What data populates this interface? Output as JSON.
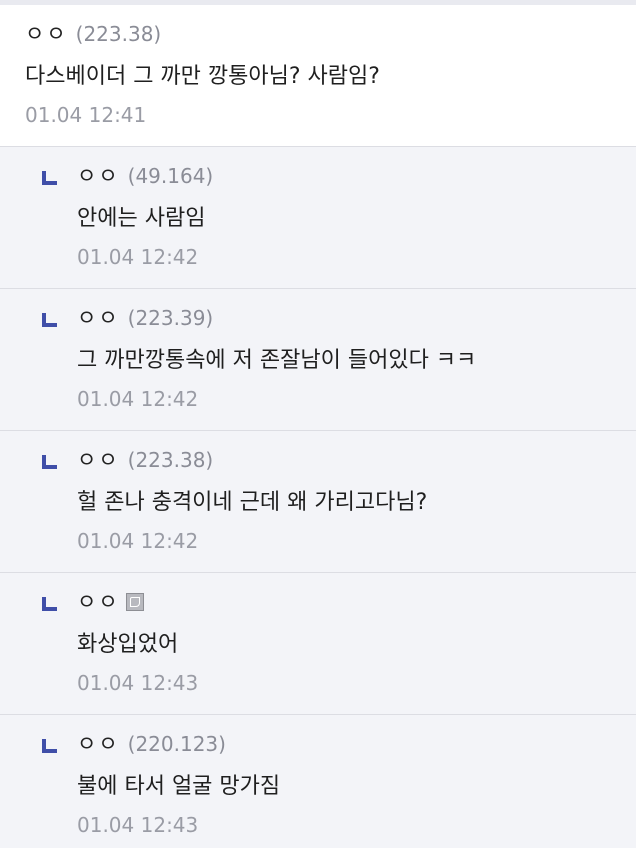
{
  "comments": [
    {
      "nick": "ㅇㅇ",
      "ip": "(223.38)",
      "content": "다스베이더 그 까만 깡통아님? 사람임?",
      "date": "01.04 12:41"
    },
    {
      "nick": "ㅇㅇ",
      "ip": "(49.164)",
      "content": "안에는 사람임",
      "date": "01.04 12:42"
    },
    {
      "nick": "ㅇㅇ",
      "ip": "(223.39)",
      "content": "그 까만깡통속에 저 존잘남이 들어있다 ㅋㅋ",
      "date": "01.04 12:42"
    },
    {
      "nick": "ㅇㅇ",
      "ip": "(223.38)",
      "content": "헐 존나 충격이네 근데 왜 가리고다님?",
      "date": "01.04 12:42"
    },
    {
      "nick": "ㅇㅇ",
      "icon": "fixed-nick-icon",
      "content": "화상입었어",
      "date": "01.04 12:43"
    },
    {
      "nick": "ㅇㅇ",
      "ip": "(220.123)",
      "content": "불에 타서 얼굴 망가짐",
      "date": "01.04 12:43"
    }
  ],
  "colors": {
    "reply_background": "#f3f4f8",
    "reply_icon": "#3f4ea8",
    "meta_text": "#8a8c96"
  }
}
